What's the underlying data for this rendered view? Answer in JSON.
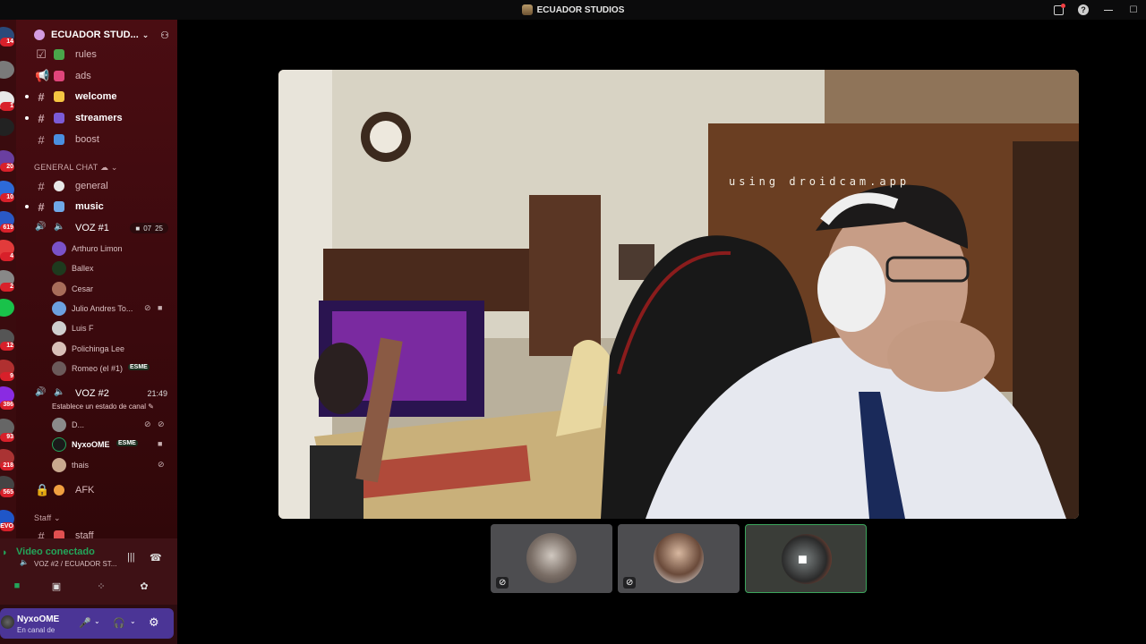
{
  "window": {
    "title": "ECUADOR STUDIOS"
  },
  "guild_badges": [
    "14",
    "1",
    "20",
    "10",
    "619",
    "4",
    "2",
    "12",
    "9",
    "386",
    "93",
    "218",
    "565",
    "EVO"
  ],
  "server": {
    "name": "ECUADOR STUD..."
  },
  "channels_top": [
    {
      "name": "rules",
      "bright": false
    },
    {
      "name": "ads",
      "bright": false
    },
    {
      "name": "welcome",
      "bright": true
    },
    {
      "name": "streamers",
      "bright": true
    },
    {
      "name": "boost",
      "bright": false
    }
  ],
  "category_general": "GENERAL CHAT",
  "channels_general": [
    {
      "name": "general",
      "bright": false
    },
    {
      "name": "music",
      "bright": true
    }
  ],
  "voz1": {
    "name": "VOZ #1",
    "video_count": "07",
    "count": "25",
    "users": [
      "Arthuro Limon",
      "Ballex",
      "Cesar",
      "Julio Andres To...",
      "Luis F",
      "Polichinga Lee",
      "Romeo (el #1)"
    ],
    "romeo_tag": "ESME"
  },
  "voz2": {
    "name": "VOZ #2",
    "timer": "21:49",
    "status": "Establece un estado de canal",
    "users": [
      "D...",
      "NyxoOME",
      "thais"
    ],
    "nyxo_tag": "ESME"
  },
  "afk": "AFK",
  "category_staff": "Staff",
  "staff_channel": "staff",
  "voice_panel": {
    "title": "Video conectado",
    "subtitle": "VOZ #2 / ECUADOR ST..."
  },
  "user_panel": {
    "name": "NyxoOME",
    "status": "En canal de"
  },
  "stream": {
    "overlay_text": "using droidcam.app"
  }
}
